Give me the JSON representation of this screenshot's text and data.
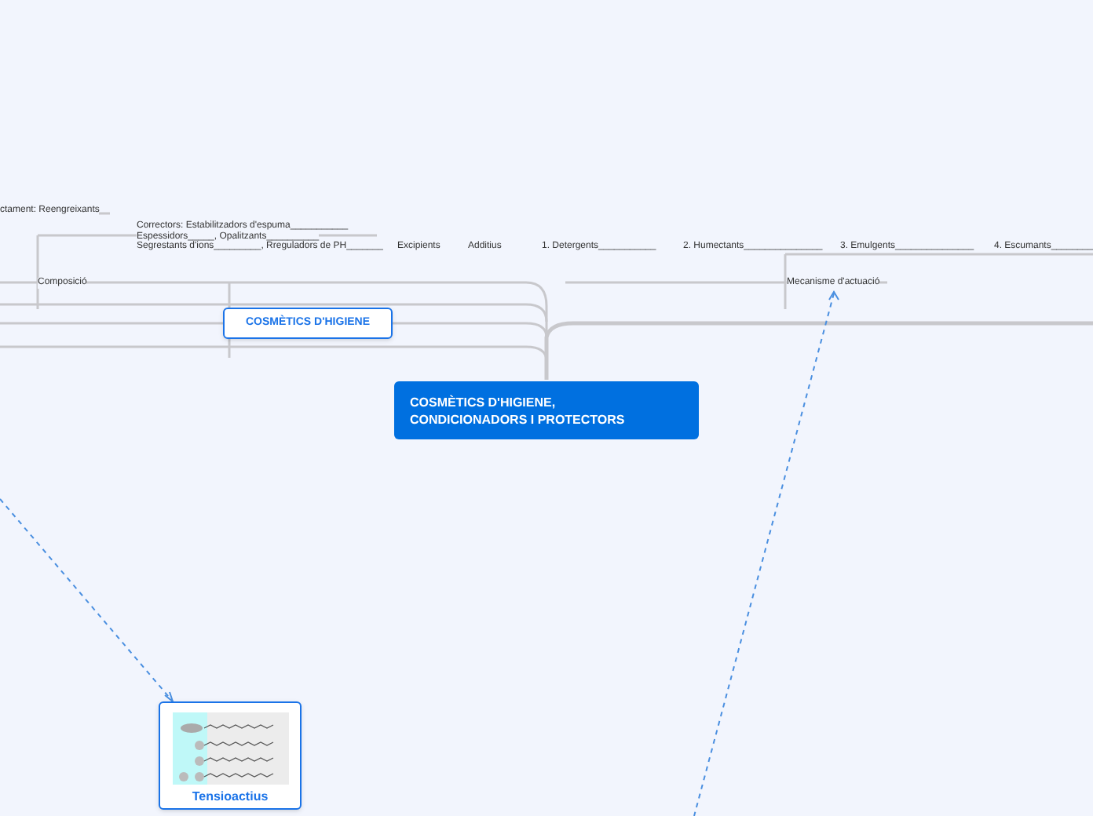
{
  "central_topic": {
    "title": "COSMÈTICS D'HIGIENE, CONDICIONADORS I PROTECTORS"
  },
  "main_topic": {
    "title": "COSMÈTICS D'HIGIENE"
  },
  "subtopics": [
    {
      "text": "ctament: Reengreixants"
    },
    {
      "text": "Correctors: Estabilitzadors d'espuma___________"
    },
    {
      "text": "Espessidors_____, Opalitzants__________"
    },
    {
      "text": "Segrestants d'ions_________, Rreguladors de PH_______"
    },
    {
      "text": "Excipients"
    },
    {
      "text": "Additius"
    },
    {
      "text": "1. Detergents___________"
    },
    {
      "text": "2. Humectants_______________"
    },
    {
      "text": "3. Emulgents_______________"
    },
    {
      "text": "4. Escumants________"
    },
    {
      "text": "Composició"
    },
    {
      "text": "Mecanisme d'actuació"
    }
  ],
  "image_card": {
    "title": "Tensioactius"
  }
}
